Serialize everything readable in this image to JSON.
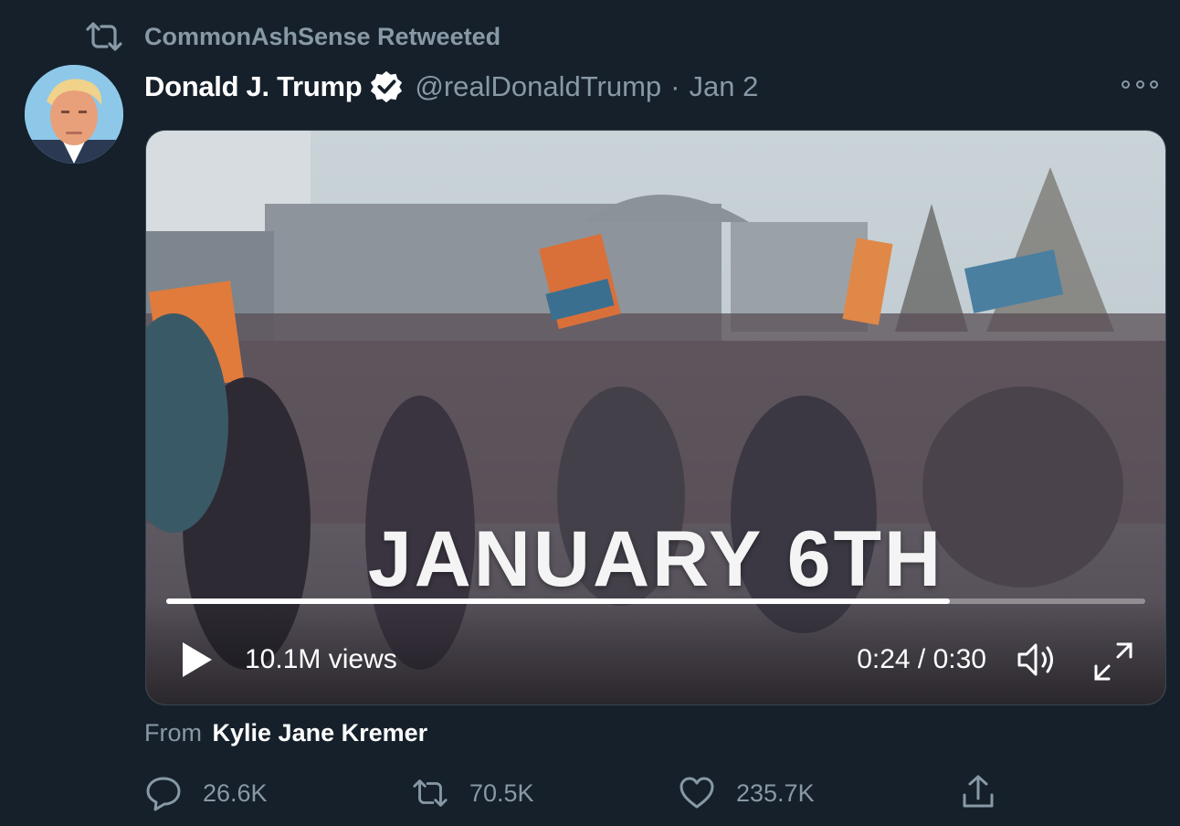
{
  "retweet": {
    "label": "CommonAshSense Retweeted"
  },
  "tweet": {
    "author_name": "Donald J. Trump",
    "handle": "@realDonaldTrump",
    "separator": "·",
    "date": "Jan 2",
    "verified": true
  },
  "media": {
    "overlay_text": "JANUARY 6TH",
    "views": "10.1M views",
    "time": "0:24 / 0:30",
    "progress": 0.8
  },
  "attribution": {
    "from_label": "From",
    "from_name": "Kylie Jane Kremer"
  },
  "actions": {
    "reply_count": "26.6K",
    "retweet_count": "70.5K",
    "like_count": "235.7K"
  },
  "colors": {
    "background": "#15202b",
    "secondary_text": "#8899a6",
    "primary_text": "#ffffff"
  }
}
